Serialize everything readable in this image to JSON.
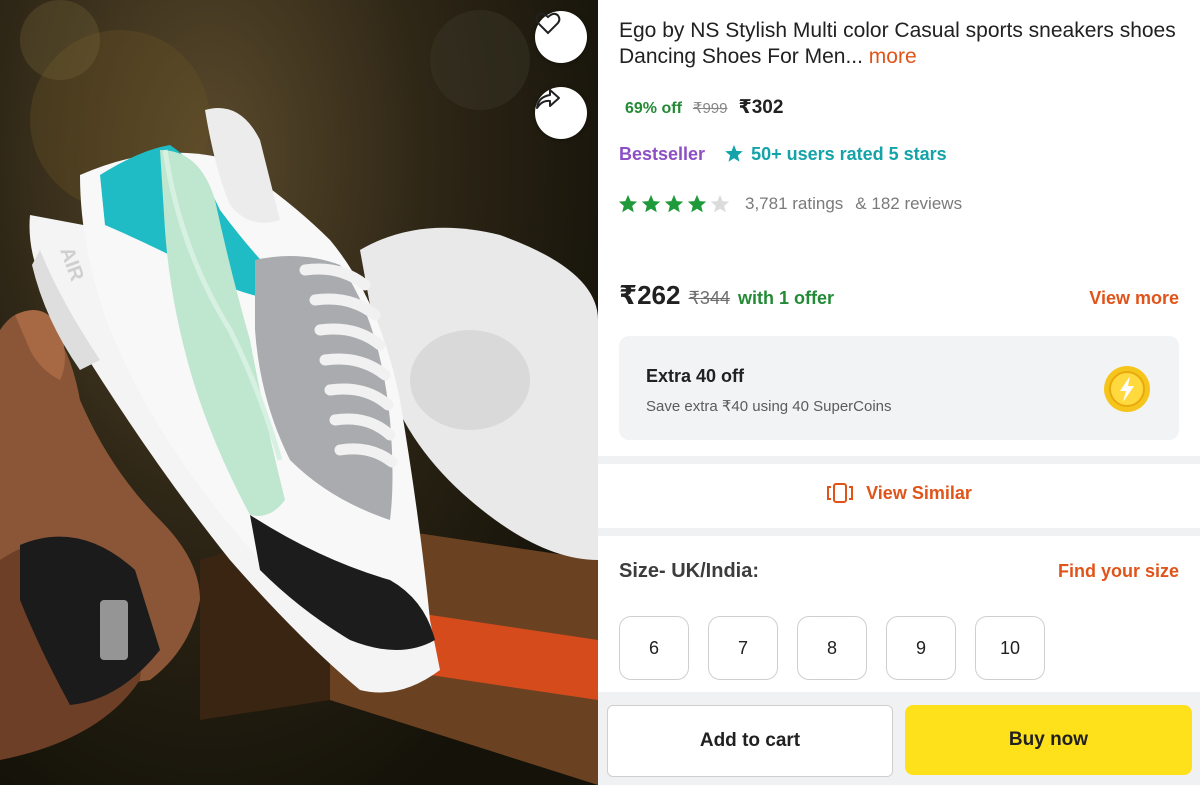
{
  "product": {
    "title": "Ego by NS Stylish Multi color Casual sports sneakers shoes Dancing Shoes For Men...",
    "more_label": "more",
    "discount": "69% off",
    "mrp": "₹999",
    "price": "₹302",
    "bestseller_label": "Bestseller",
    "rated_badge": "50+ users rated 5 stars",
    "star_rating": 4,
    "ratings_count": "3,781 ratings",
    "reviews_count": "& 182 reviews"
  },
  "offer": {
    "final_price": "₹262",
    "strike_price": "₹344",
    "offer_text": "with 1 offer",
    "view_more_label": "View more"
  },
  "supercoins": {
    "title": "Extra 40 off",
    "subtitle": "Save extra ₹40 using 40 SuperCoins",
    "icon": "supercoin-icon"
  },
  "view_similar_label": "View Similar",
  "size_section": {
    "label": "Size- UK/India:",
    "find_label": "Find your size",
    "sizes": [
      "6",
      "7",
      "8",
      "9",
      "10"
    ]
  },
  "actions": {
    "add_to_cart": "Add to cart",
    "buy_now": "Buy now"
  },
  "photo": {
    "logo_text": "AIR",
    "icons": [
      "heart-icon",
      "share-icon"
    ]
  },
  "colors": {
    "accent_orange": "#e0541a",
    "discount_green": "#238a35",
    "bestseller_purple": "#8c4fc4",
    "teal": "#14a3a8",
    "buy_yellow": "#ffe11b",
    "star_green": "#1f9a3a"
  }
}
